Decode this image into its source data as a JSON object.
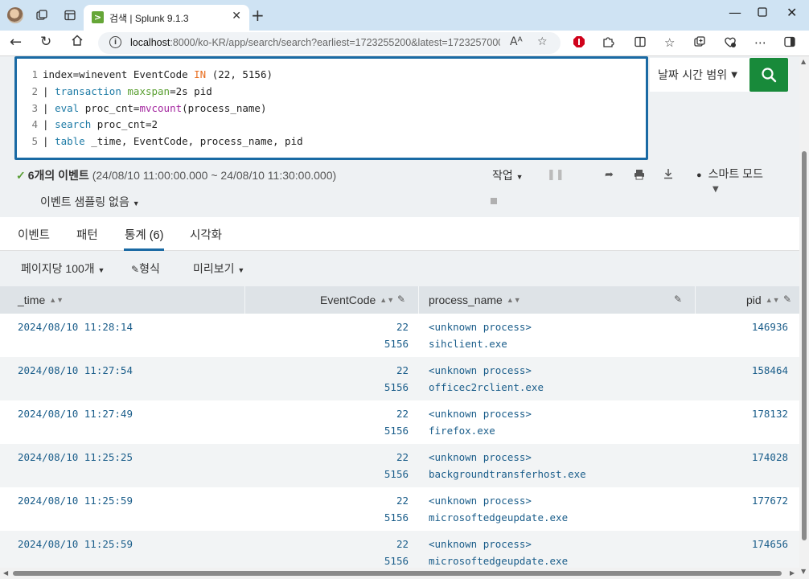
{
  "browser": {
    "tab_title": "검색 | Splunk 9.1.3",
    "tab_favicon": ">",
    "url_host": "localhost",
    "url_path": ":8000/ko-KR/app/search/search?earliest=1723255200&latest=1723257000&q...",
    "reader_icon": "Aᴬ"
  },
  "search": {
    "line_numbers": [
      "1",
      "2",
      "3",
      "4",
      "5"
    ],
    "time_range_label": "날짜 시간 범위"
  },
  "status": {
    "event_count": "6개의 이벤트",
    "range": "(24/08/10 11:00:00.000 ~ 24/08/10 11:30:00.000)",
    "job_label": "작업",
    "smart_mode": "스마트 모드",
    "sampling": "이벤트 샘플링 없음"
  },
  "tabs": [
    "이벤트",
    "패턴",
    "통계 (6)",
    "시각화"
  ],
  "options": {
    "per_page": "페이지당 100개",
    "format": "형식",
    "preview": "미리보기"
  },
  "table": {
    "columns": [
      "_time",
      "EventCode",
      "process_name",
      "pid"
    ],
    "rows": [
      {
        "time": "2024/08/10 11:28:14",
        "codes": [
          "22",
          "5156"
        ],
        "procs": [
          "<unknown process>",
          "sihclient.exe"
        ],
        "pid": "146936"
      },
      {
        "time": "2024/08/10 11:27:54",
        "codes": [
          "22",
          "5156"
        ],
        "procs": [
          "<unknown process>",
          "officec2rclient.exe"
        ],
        "pid": "158464"
      },
      {
        "time": "2024/08/10 11:27:49",
        "codes": [
          "22",
          "5156"
        ],
        "procs": [
          "<unknown process>",
          "firefox.exe"
        ],
        "pid": "178132"
      },
      {
        "time": "2024/08/10 11:25:25",
        "codes": [
          "22",
          "5156"
        ],
        "procs": [
          "<unknown process>",
          "backgroundtransferhost.exe"
        ],
        "pid": "174028"
      },
      {
        "time": "2024/08/10 11:25:59",
        "codes": [
          "22",
          "5156"
        ],
        "procs": [
          "<unknown process>",
          "microsoftedgeupdate.exe"
        ],
        "pid": "177672"
      },
      {
        "time": "2024/08/10 11:25:59",
        "codes": [
          "22",
          "5156"
        ],
        "procs": [
          "<unknown process>",
          "microsoftedgeupdate.exe"
        ],
        "pid": "174656"
      }
    ]
  },
  "colors": {
    "accent": "#1a6aa4",
    "search_button": "#188a3a",
    "splunk_green": "#65a637"
  }
}
